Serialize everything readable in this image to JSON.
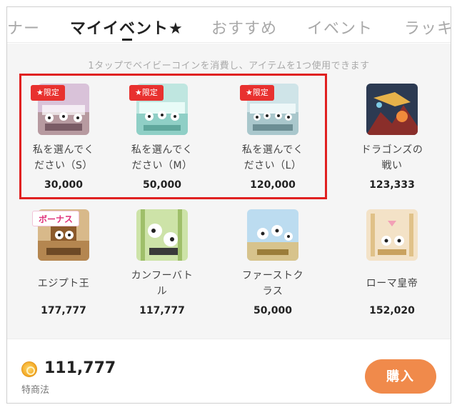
{
  "tabs": [
    {
      "label": "ナー"
    },
    {
      "label": "マイイベント★"
    },
    {
      "label": "おすすめ"
    },
    {
      "label": "イベント"
    },
    {
      "label": "ラッキ"
    }
  ],
  "hint": "1タップでベイビーコインを消費し、アイテムを1つ使用できます",
  "items": [
    {
      "name_l1": "私を選んでく",
      "name_l2": "ださい（S）",
      "price": "30,000",
      "badge": "★限定"
    },
    {
      "name_l1": "私を選んでく",
      "name_l2": "ださい（M）",
      "price": "50,000",
      "badge": "★限定"
    },
    {
      "name_l1": "私を選んでく",
      "name_l2": "ださい（L）",
      "price": "120,000",
      "badge": "★限定"
    },
    {
      "name_l1": "ドラゴンズの",
      "name_l2": "戦い",
      "price": "123,333"
    },
    {
      "name_l1": "エジプト王",
      "name_l2": "",
      "price": "177,777",
      "badge": "ボーナス"
    },
    {
      "name_l1": "カンフーバト",
      "name_l2": "ル",
      "price": "117,777"
    },
    {
      "name_l1": "ファーストク",
      "name_l2": "ラス",
      "price": "50,000"
    },
    {
      "name_l1": "ローマ皇帝",
      "name_l2": "",
      "price": "152,020"
    }
  ],
  "footer": {
    "coin_amount": "111,777",
    "law_link": "特商法",
    "buy_label": "購入"
  },
  "colors": {
    "accent_orange": "#f08a4b",
    "limited_red": "#e8312f",
    "bonus_pink": "#e0307a",
    "highlight_red": "#e02020"
  },
  "icons": {
    "coin": "baby-coin-icon"
  }
}
